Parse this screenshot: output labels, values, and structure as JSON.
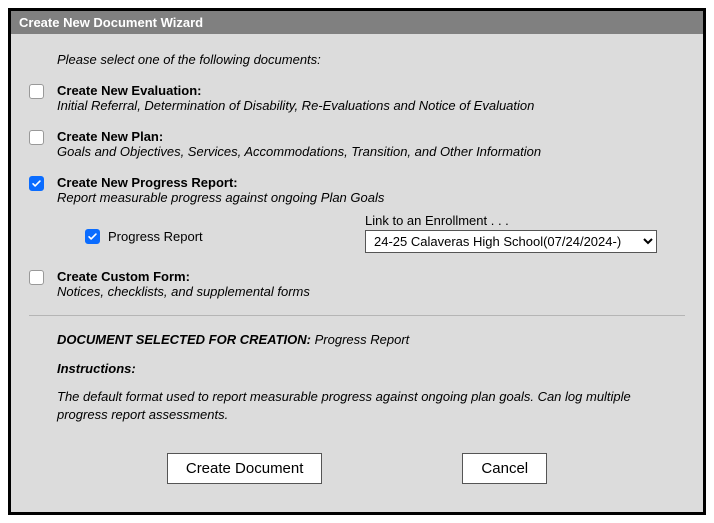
{
  "window": {
    "title": "Create New Document Wizard"
  },
  "intro": "Please select one of the following documents:",
  "options": {
    "evaluation": {
      "title": "Create New Evaluation:",
      "desc": "Initial Referral, Determination of Disability, Re-Evaluations and Notice of Evaluation",
      "checked": false
    },
    "plan": {
      "title": "Create New Plan:",
      "desc": "Goals and Objectives, Services, Accommodations, Transition, and Other Information",
      "checked": false
    },
    "progress": {
      "title": "Create New Progress Report:",
      "desc": "Report measurable progress against ongoing Plan Goals",
      "checked": true,
      "sub": {
        "checked": true,
        "label": "Progress Report",
        "link_label": "Link to an Enrollment . . .",
        "enrollment": "24-25 Calaveras High School(07/24/2024-)"
      }
    },
    "custom": {
      "title": "Create Custom Form:",
      "desc": "Notices, checklists, and supplemental forms",
      "checked": false
    }
  },
  "selected": {
    "label": "DOCUMENT SELECTED FOR CREATION:",
    "value": "Progress Report"
  },
  "instructions": {
    "heading": "Instructions:",
    "body": "The default format used to report measurable progress against ongoing plan goals. Can log multiple progress report assessments."
  },
  "buttons": {
    "create": "Create Document",
    "cancel": "Cancel"
  }
}
